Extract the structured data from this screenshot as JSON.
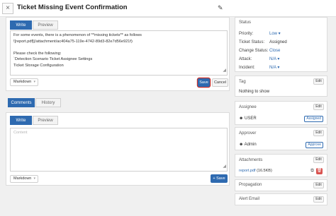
{
  "header": {
    "close_icon": "×",
    "title": "Ticket Missing Event Confirmation",
    "edit_icon": "✎"
  },
  "editor": {
    "tabs": [
      "Write",
      "Preview"
    ],
    "lines": [
      "For some events, there is a phenomenon of **missing tickets** as follows",
      "![report.pdf](/attachment/ac404a75-119e-4742-89d3-82e7d56e921f)",
      "",
      "Please check the following:",
      "`Detection Scenario Ticket Assignee Settings",
      "Ticket Storage Configuration"
    ],
    "format": "Markdown",
    "save": "Save",
    "cancel": "Cancel"
  },
  "comments": {
    "tabs": [
      "Comments",
      "History"
    ],
    "write_tabs": [
      "Write",
      "Preview"
    ],
    "placeholder": "Content",
    "format": "Markdown",
    "save": "+ Save"
  },
  "status": {
    "title": "Status",
    "rows": [
      {
        "key": "Priority:",
        "value": "Low ▾"
      },
      {
        "key": "Ticket Status:",
        "value": "Assigned"
      },
      {
        "key": "Change Status:",
        "value": "Close"
      },
      {
        "key": "Attack:",
        "value": "N/A ▾"
      },
      {
        "key": "Incident:",
        "value": "N/A ▾"
      }
    ]
  },
  "tag": {
    "title": "Tag",
    "edit": "Edit",
    "empty": "Nothing to show"
  },
  "assignee": {
    "title": "Assignee",
    "edit": "Edit",
    "user": "USER",
    "badge": "Assigned"
  },
  "approver": {
    "title": "Approver",
    "edit": "Edit",
    "user": "Admin",
    "badge": "Approve"
  },
  "attachments": {
    "title": "Attachments",
    "edit": "Edit",
    "file": "report.pdf",
    "size": "(16.5KB)"
  },
  "propagation": {
    "title": "Propagation",
    "edit": "Edit"
  },
  "alert_email": {
    "title": "Alert Email",
    "edit": "Edit"
  },
  "colors": {
    "accent": "#2e6ab0",
    "danger": "#d9534f",
    "highlight": "#c9302c"
  }
}
